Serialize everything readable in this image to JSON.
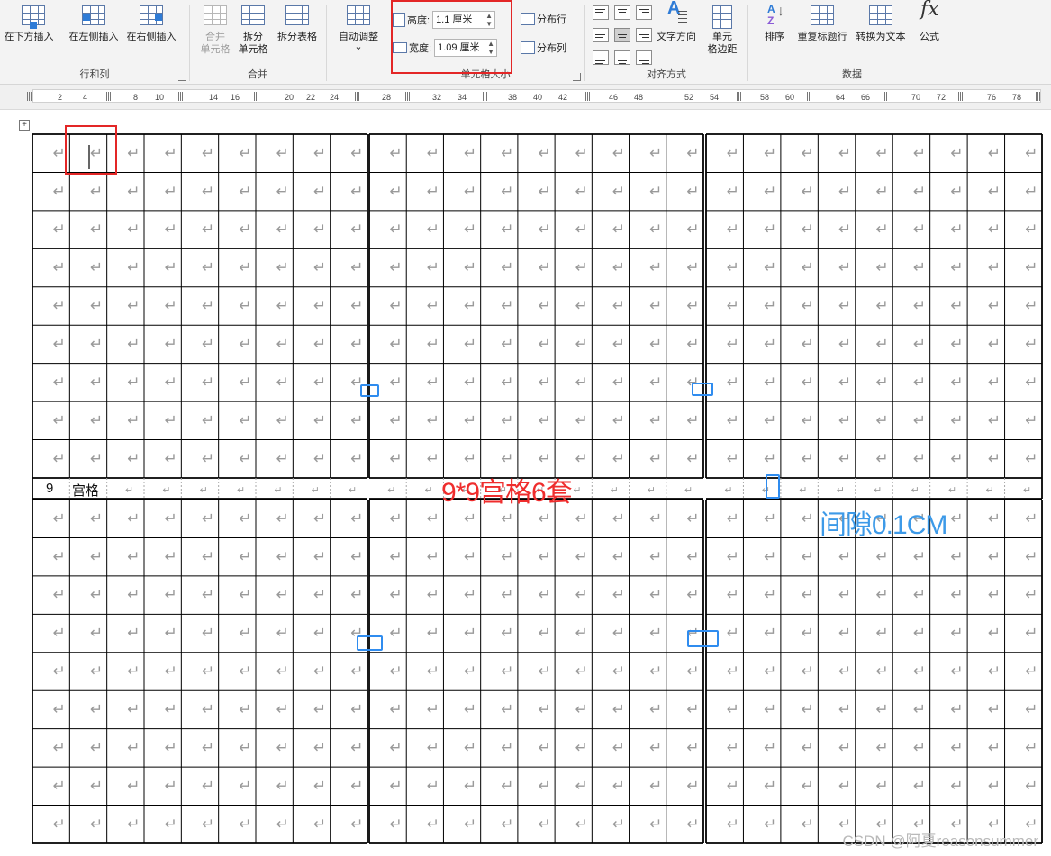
{
  "ribbon": {
    "rows_cols": {
      "insert_below": "在下方插入",
      "insert_left": "在左侧插入",
      "insert_right": "在右侧插入",
      "group_label": "行和列"
    },
    "merge": {
      "merge_cells_line1": "合并",
      "merge_cells_line2": "单元格",
      "split_cells_line1": "拆分",
      "split_cells_line2": "单元格",
      "split_table": "拆分表格",
      "group_label": "合并"
    },
    "autofit": {
      "label": "自动调整",
      "chevron": "⌄"
    },
    "cell_size": {
      "height_label": "高度:",
      "height_value": "1.1 厘米",
      "width_label": "宽度:",
      "width_value": "1.09 厘米",
      "distribute_rows": "分布行",
      "distribute_cols": "分布列",
      "group_label": "单元格大小"
    },
    "alignment": {
      "text_direction": "文字方向",
      "cell_margins_line1": "单元",
      "cell_margins_line2": "格边距",
      "group_label": "对齐方式",
      "selected_index": 4
    },
    "data": {
      "sort": "排序",
      "repeat_header": "重复标题行",
      "convert_to_text": "转换为文本",
      "formula": "公式",
      "formula_glyph": "fx",
      "group_label": "数据"
    }
  },
  "ruler": {
    "numbers": [
      "2",
      "4",
      "8",
      "10",
      "14",
      "16",
      "20",
      "22",
      "24",
      "28",
      "32",
      "34",
      "38",
      "40",
      "42",
      "46",
      "48",
      "52",
      "54",
      "58",
      "60",
      "64",
      "66",
      "70",
      "72",
      "76",
      "78"
    ]
  },
  "document": {
    "move_handle_glyph": "+",
    "mid_row_number": "9",
    "mid_row_text": "宫格",
    "paragraph_mark": "↵",
    "annotation_title": "9*9宫格6套",
    "annotation_gap": "间隙0.1CM",
    "accent_red": "#e32626",
    "accent_blue": "#2f8cef"
  },
  "watermark": "CSDN @阿夏reasonsummer"
}
